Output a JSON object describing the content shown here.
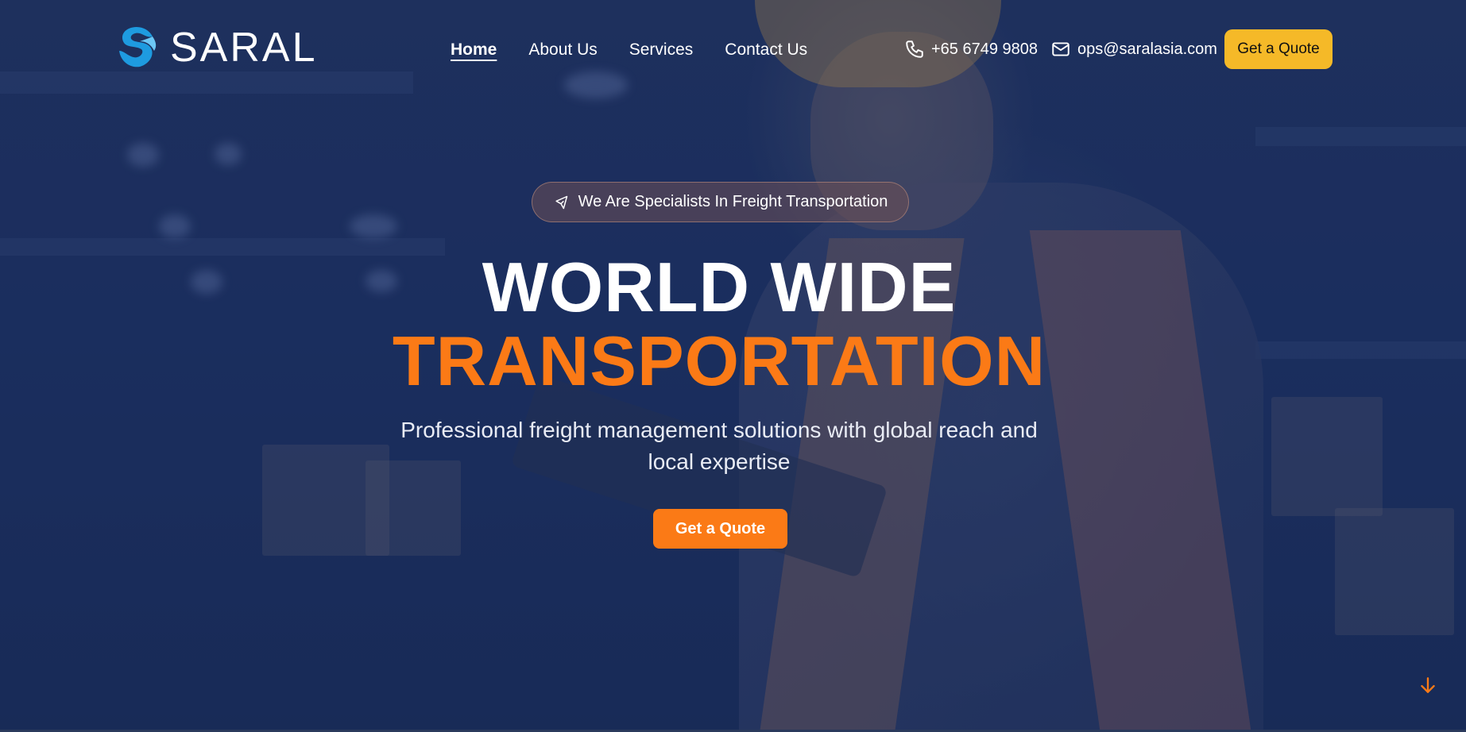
{
  "header": {
    "logo_text": "SARAL",
    "nav": [
      {
        "label": "Home",
        "active": true
      },
      {
        "label": "About Us",
        "active": false
      },
      {
        "label": "Services",
        "active": false
      },
      {
        "label": "Contact Us",
        "active": false
      }
    ],
    "phone": "+65 6749 9808",
    "email": "ops@saralasia.com",
    "quote_button": "Get a Quote"
  },
  "hero": {
    "badge": "We Are Specialists In Freight Transportation",
    "headline_line1": "WORLD WIDE",
    "headline_line2": "TRANSPORTATION",
    "subtitle": "Professional freight management solutions with global reach and local expertise",
    "cta_button": "Get a Quote"
  },
  "icons": {
    "logo": "saral-logo-icon",
    "phone": "phone-icon",
    "email": "mail-icon",
    "badge": "plane-icon",
    "scroll": "arrow-down-icon"
  },
  "colors": {
    "accent_orange": "#fb7a16",
    "quote_yellow": "#f5b928",
    "logo_blue": "#1e9be0",
    "overlay_navy": "#1d3060"
  }
}
